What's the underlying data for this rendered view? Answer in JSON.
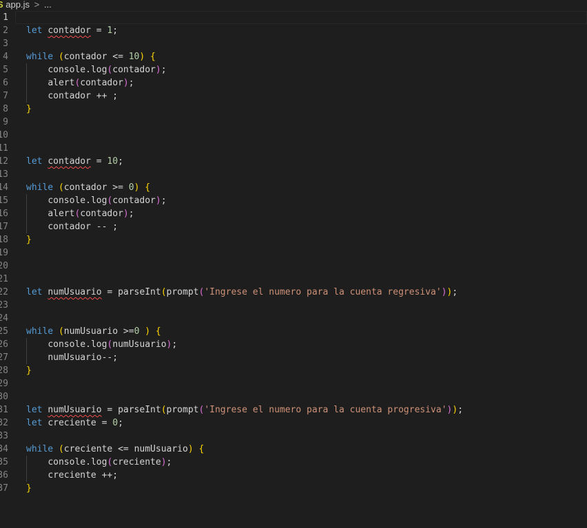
{
  "breadcrumb": {
    "file": "app.js",
    "separator": ">",
    "ellipsis": "..."
  },
  "editor": {
    "lines": [
      {
        "n": "1",
        "current": true,
        "tokens": []
      },
      {
        "n": "2",
        "tokens": [
          [
            "kw",
            "let"
          ],
          [
            "p",
            " "
          ],
          [
            "var squig",
            "contador"
          ],
          [
            "p",
            " = "
          ],
          [
            "num",
            "1"
          ],
          [
            "p",
            ";"
          ]
        ]
      },
      {
        "n": "3",
        "tokens": []
      },
      {
        "n": "4",
        "tokens": [
          [
            "kw",
            "while"
          ],
          [
            "p",
            " "
          ],
          [
            "b1",
            "("
          ],
          [
            "var",
            "contador"
          ],
          [
            "p",
            " <= "
          ],
          [
            "num",
            "10"
          ],
          [
            "b1",
            ")"
          ],
          [
            "p",
            " "
          ],
          [
            "b1",
            "{"
          ]
        ]
      },
      {
        "n": "5",
        "indent": 1,
        "tokens": [
          [
            "var",
            "console"
          ],
          [
            "p",
            "."
          ],
          [
            "fn",
            "log"
          ],
          [
            "b2",
            "("
          ],
          [
            "var",
            "contador"
          ],
          [
            "b2",
            ")"
          ],
          [
            "p",
            ";"
          ]
        ]
      },
      {
        "n": "6",
        "indent": 1,
        "tokens": [
          [
            "fn",
            "alert"
          ],
          [
            "b2",
            "("
          ],
          [
            "var",
            "contador"
          ],
          [
            "b2",
            ")"
          ],
          [
            "p",
            ";"
          ]
        ]
      },
      {
        "n": "7",
        "indent": 1,
        "tokens": [
          [
            "var",
            "contador"
          ],
          [
            "p",
            " ++ ;"
          ]
        ]
      },
      {
        "n": "8",
        "tokens": [
          [
            "b1",
            "}"
          ]
        ]
      },
      {
        "n": "9",
        "tokens": []
      },
      {
        "n": "10",
        "tokens": []
      },
      {
        "n": "11",
        "tokens": []
      },
      {
        "n": "12",
        "tokens": [
          [
            "kw",
            "let"
          ],
          [
            "p",
            " "
          ],
          [
            "var squig",
            "contador"
          ],
          [
            "p",
            " = "
          ],
          [
            "num",
            "10"
          ],
          [
            "p",
            ";"
          ]
        ]
      },
      {
        "n": "13",
        "tokens": []
      },
      {
        "n": "14",
        "tokens": [
          [
            "kw",
            "while"
          ],
          [
            "p",
            " "
          ],
          [
            "b1",
            "("
          ],
          [
            "var",
            "contador"
          ],
          [
            "p",
            " >= "
          ],
          [
            "num",
            "0"
          ],
          [
            "b1",
            ")"
          ],
          [
            "p",
            " "
          ],
          [
            "b1",
            "{"
          ]
        ]
      },
      {
        "n": "15",
        "indent": 1,
        "tokens": [
          [
            "var",
            "console"
          ],
          [
            "p",
            "."
          ],
          [
            "fn",
            "log"
          ],
          [
            "b2",
            "("
          ],
          [
            "var",
            "contador"
          ],
          [
            "b2",
            ")"
          ],
          [
            "p",
            ";"
          ]
        ]
      },
      {
        "n": "16",
        "indent": 1,
        "tokens": [
          [
            "fn",
            "alert"
          ],
          [
            "b2",
            "("
          ],
          [
            "var",
            "contador"
          ],
          [
            "b2",
            ")"
          ],
          [
            "p",
            ";"
          ]
        ]
      },
      {
        "n": "17",
        "indent": 1,
        "tokens": [
          [
            "var",
            "contador"
          ],
          [
            "p",
            " -- ;"
          ]
        ]
      },
      {
        "n": "18",
        "tokens": [
          [
            "b1",
            "}"
          ]
        ]
      },
      {
        "n": "19",
        "tokens": []
      },
      {
        "n": "20",
        "tokens": []
      },
      {
        "n": "21",
        "tokens": []
      },
      {
        "n": "22",
        "tokens": [
          [
            "kw",
            "let"
          ],
          [
            "p",
            " "
          ],
          [
            "var squig",
            "numUsuario"
          ],
          [
            "p",
            " = "
          ],
          [
            "fn",
            "parseInt"
          ],
          [
            "b1",
            "("
          ],
          [
            "fn",
            "prompt"
          ],
          [
            "b2",
            "("
          ],
          [
            "str",
            "'Ingrese el numero para la cuenta regresiva'"
          ],
          [
            "b2",
            ")"
          ],
          [
            "b1",
            ")"
          ],
          [
            "p",
            ";"
          ]
        ]
      },
      {
        "n": "23",
        "tokens": []
      },
      {
        "n": "24",
        "tokens": []
      },
      {
        "n": "25",
        "tokens": [
          [
            "kw",
            "while"
          ],
          [
            "p",
            " "
          ],
          [
            "b1",
            "("
          ],
          [
            "var",
            "numUsuario"
          ],
          [
            "p",
            " >="
          ],
          [
            "num",
            "0"
          ],
          [
            "p",
            " "
          ],
          [
            "b1",
            ")"
          ],
          [
            "p",
            " "
          ],
          [
            "b1",
            "{"
          ]
        ]
      },
      {
        "n": "26",
        "indent": 1,
        "tokens": [
          [
            "var",
            "console"
          ],
          [
            "p",
            "."
          ],
          [
            "fn",
            "log"
          ],
          [
            "b2",
            "("
          ],
          [
            "var",
            "numUsuario"
          ],
          [
            "b2",
            ")"
          ],
          [
            "p",
            ";"
          ]
        ]
      },
      {
        "n": "27",
        "indent": 1,
        "tokens": [
          [
            "var",
            "numUsuario"
          ],
          [
            "p",
            "--;"
          ]
        ]
      },
      {
        "n": "28",
        "tokens": [
          [
            "b1",
            "}"
          ]
        ]
      },
      {
        "n": "29",
        "tokens": []
      },
      {
        "n": "30",
        "tokens": []
      },
      {
        "n": "31",
        "tokens": [
          [
            "kw",
            "let"
          ],
          [
            "p",
            " "
          ],
          [
            "var squig",
            "numUsuario"
          ],
          [
            "p",
            " = "
          ],
          [
            "fn",
            "parseInt"
          ],
          [
            "b1",
            "("
          ],
          [
            "fn",
            "prompt"
          ],
          [
            "b2",
            "("
          ],
          [
            "str",
            "'Ingrese el numero para la cuenta progresiva'"
          ],
          [
            "b2",
            ")"
          ],
          [
            "b1",
            ")"
          ],
          [
            "p",
            ";"
          ]
        ]
      },
      {
        "n": "32",
        "tokens": [
          [
            "kw",
            "let"
          ],
          [
            "p",
            " "
          ],
          [
            "var",
            "creciente"
          ],
          [
            "p",
            " = "
          ],
          [
            "num",
            "0"
          ],
          [
            "p",
            ";"
          ]
        ]
      },
      {
        "n": "33",
        "tokens": []
      },
      {
        "n": "34",
        "tokens": [
          [
            "kw",
            "while"
          ],
          [
            "p",
            " "
          ],
          [
            "b1",
            "("
          ],
          [
            "var",
            "creciente"
          ],
          [
            "p",
            " <= "
          ],
          [
            "var",
            "numUsuario"
          ],
          [
            "b1",
            ")"
          ],
          [
            "p",
            " "
          ],
          [
            "b1",
            "{"
          ]
        ]
      },
      {
        "n": "35",
        "indent": 1,
        "tokens": [
          [
            "var",
            "console"
          ],
          [
            "p",
            "."
          ],
          [
            "fn",
            "log"
          ],
          [
            "b2",
            "("
          ],
          [
            "var",
            "creciente"
          ],
          [
            "b2",
            ")"
          ],
          [
            "p",
            ";"
          ]
        ]
      },
      {
        "n": "36",
        "indent": 1,
        "tokens": [
          [
            "var",
            "creciente"
          ],
          [
            "p",
            " ++;"
          ]
        ]
      },
      {
        "n": "37",
        "tokens": [
          [
            "b1",
            "}"
          ]
        ]
      }
    ]
  }
}
